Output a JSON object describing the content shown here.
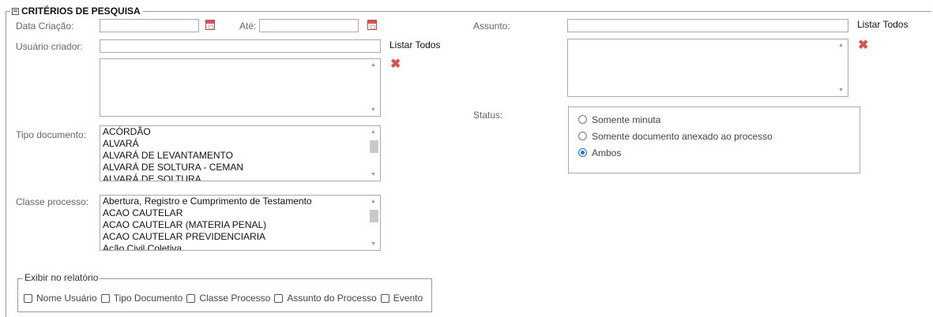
{
  "fieldset": {
    "title": "CRITÉRIOS DE PESQUISA"
  },
  "data_criacao": {
    "label": "Data Criação:",
    "ate_label": "Até:",
    "from_value": "",
    "to_value": ""
  },
  "usuario_criador": {
    "label": "Usuário criador:",
    "value": "",
    "listar_todos": "Listar Todos"
  },
  "tipo_documento": {
    "label": "Tipo documento:",
    "options": [
      "ACÓRDÃO",
      "ALVARÁ",
      "ALVARÁ DE LEVANTAMENTO",
      "ALVARÁ DE SOLTURA - CEMAN",
      "ALVARÁ DE SOLTURA"
    ]
  },
  "classe_processo": {
    "label": "Classe processo:",
    "options": [
      "Abertura, Registro e Cumprimento de Testamento",
      "ACAO CAUTELAR",
      "ACAO CAUTELAR (MATERIA PENAL)",
      "ACAO CAUTELAR PREVIDENCIARIA",
      "Ação Civil Coletiva"
    ]
  },
  "assunto": {
    "label": "Assunto:",
    "value": "",
    "listar_todos": "Listar Todos"
  },
  "status": {
    "label": "Status:",
    "options": [
      "Somente minuta",
      "Somente documento anexado ao processo",
      "Ambos"
    ],
    "selected": "Ambos"
  },
  "exibir": {
    "legend": "Exibir no relatório",
    "options": [
      "Nome Usuário",
      "Tipo Documento",
      "Classe Processo",
      "Assunto do Processo",
      "Evento"
    ]
  },
  "colors": {
    "accent": "#1a73e8",
    "remove": "#e05050",
    "border": "#a9a9a9"
  }
}
